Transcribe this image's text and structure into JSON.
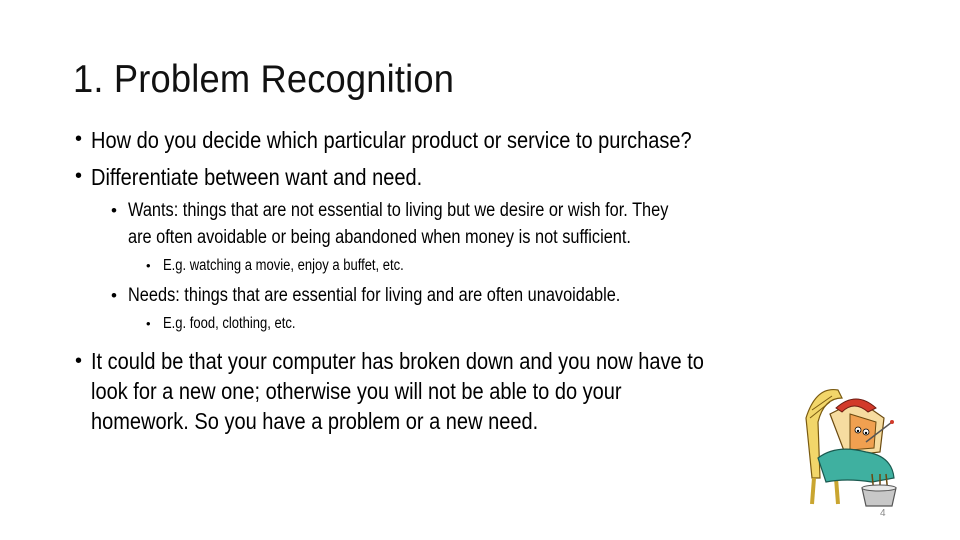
{
  "slide": {
    "title": "1. Problem Recognition",
    "bullets": [
      {
        "level": 1,
        "text": "How do you decide which particular product or service to purchase?"
      },
      {
        "level": 1,
        "text": "Differentiate between want and need."
      },
      {
        "level": 2,
        "text": "Wants: things that are not essential to living but we desire or wish for.  They",
        "cont": "are often avoidable or being abandoned when money is not sufficient."
      },
      {
        "level": 3,
        "text": "E.g. watching a movie, enjoy a buffet, etc."
      },
      {
        "level": 2,
        "text": "Needs: things that are essential for living and are often unavoidable."
      },
      {
        "level": 3,
        "text": "E.g. food, clothing, etc."
      },
      {
        "level": 1,
        "text": "It could be that your computer has broken down and you now have to",
        "cont": "look for a new one; otherwise you will not be able to do your",
        "cont2": "homework.  So you have a problem or a new need."
      }
    ],
    "bullet_glyph": "•",
    "page_number": "4",
    "clipart": "sick-computer-clipart"
  }
}
